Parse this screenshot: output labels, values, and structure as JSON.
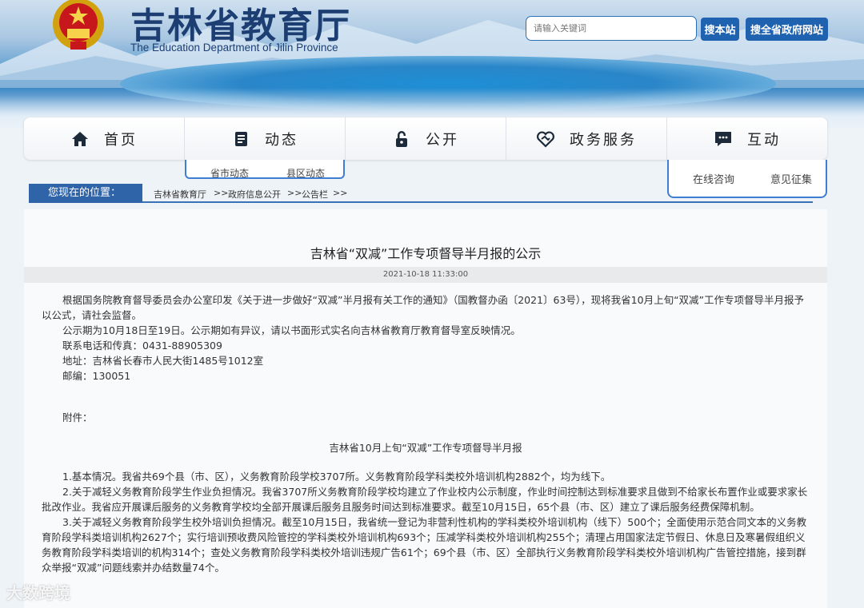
{
  "header": {
    "title": "吉林省教育厅",
    "subtitle": "The Education Department of Jilin Province",
    "search_placeholder": "请输入关键词",
    "search_site_label": "搜本站",
    "search_all_label": "搜全省政府网站"
  },
  "nav": {
    "items": [
      {
        "label": "首页",
        "icon": "home-icon"
      },
      {
        "label": "动态",
        "icon": "document-icon"
      },
      {
        "label": "公开",
        "icon": "lock-icon"
      },
      {
        "label": "政务服务",
        "icon": "handshake-heart-icon"
      },
      {
        "label": "互动",
        "icon": "chat-icon"
      }
    ],
    "dongtai_submenu": [
      "省市动态",
      "县区动态"
    ],
    "hudong_submenu": [
      "在线咨询",
      "意见征集"
    ]
  },
  "breadcrumb": {
    "label": "您现在的位置：",
    "items": [
      "吉林省教育厅",
      "政府信息公开",
      "公告栏"
    ],
    "separator": ">>"
  },
  "article": {
    "title": "吉林省“双减”工作专项督导半月报的公示",
    "date": "2021-10-18 11:33:00",
    "paragraphs": [
      "根据国务院教育督导委员会办公室印发《关于进一步做好“双减”半月报有关工作的通知》（国教督办函〔2021〕63号），现将我省10月上旬“双减”工作专项督导半月报予以公式，请社会监督。",
      "公示期为10月18日至19日。公示期如有异议，请以书面形式实名向吉林省教育厅教育督导室反映情况。",
      "联系电话和传真：0431-88905309",
      "地址：吉林省长春市人民大街1485号1012室",
      "邮编：130051"
    ],
    "attachment_label": "附件：",
    "attachment_title": "吉林省10月上旬“双减”工作专项督导半月报",
    "report": [
      "1.基本情况。我省共69个县（市、区），义务教育阶段学校3707所。义务教育阶段学科类校外培训机构2882个，均为线下。",
      "2.关于减轻义务教育阶段学生作业负担情况。我省3707所义务教育阶段学校均建立了作业校内公示制度，作业时间控制达到标准要求且做到不给家长布置作业或要求家长批改作业。我省应开展课后服务的义务教育学校均全部开展课后服务且服务时间达到标准要求。截至10月15日，65个县（市、区）建立了课后服务经费保障机制。",
      "3.关于减轻义务教育阶段学生校外培训负担情况。截至10月15日，我省统一登记为非营利性机构的学科类校外培训机构（线下）500个；全面使用示范合同文本的义务教育阶段学科类培训机构2627个；实行培训预收费风险管控的学科类校外培训机构693个；压减学科类校外培训机构255个；清理占用国家法定节假日、休息日及寒暑假组织义务教育阶段学科类培训的机构314个；查处义务教育阶段学科类校外培训违规广告61个；69个县（市、区）全部执行义务教育阶段学科类校外培训机构广告管控措施，接到群众举报“双减”问题线索并办结数量74个。"
    ]
  },
  "watermark": "大数跨境"
}
